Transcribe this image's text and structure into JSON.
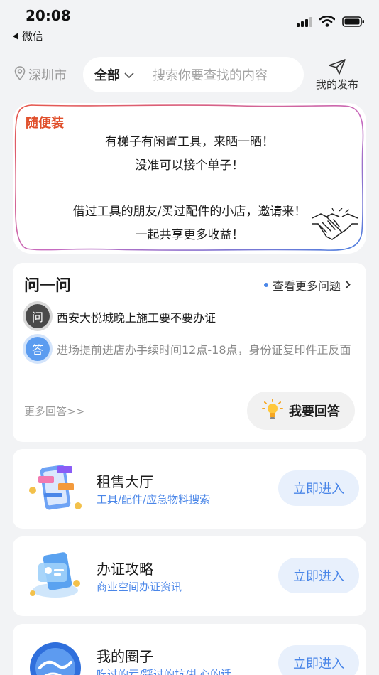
{
  "status_bar": {
    "time": "20:08",
    "back_app": "微信"
  },
  "header": {
    "city": "深圳市",
    "category": "全部",
    "search_placeholder": "搜索你要查找的内容",
    "publish_label": "我的发布"
  },
  "banner": {
    "tag": "随便装",
    "lines": [
      "有梯子有闲置工具，来晒一晒！",
      "没准可以接个单子！",
      "借过工具的朋友/买过配件的小店，邀请来！",
      "一起共享更多收益！"
    ]
  },
  "qa": {
    "title": "问一问",
    "more_questions": "查看更多问题",
    "q_badge": "问",
    "question": "西安大悦城晚上施工要不要办证",
    "a_badge": "答",
    "answer": "进场提前进店办手续时间12点-18点，身份证复印件正反面",
    "more_answers": "更多回答>>",
    "answer_button": "我要回答"
  },
  "entries": [
    {
      "title": "租售大厅",
      "subtitle": "工具/配件/应急物料搜索",
      "button": "立即进入"
    },
    {
      "title": "办证攻略",
      "subtitle": "商业空间办证资讯",
      "button": "立即进入"
    },
    {
      "title": "我的圈子",
      "subtitle": "吃过的亏/踩过的坑/扎心的话",
      "button": "立即进入"
    }
  ],
  "colors": {
    "accent_blue": "#4a86e8",
    "tag_red": "#e04f2b",
    "background": "#f2f3f5"
  }
}
